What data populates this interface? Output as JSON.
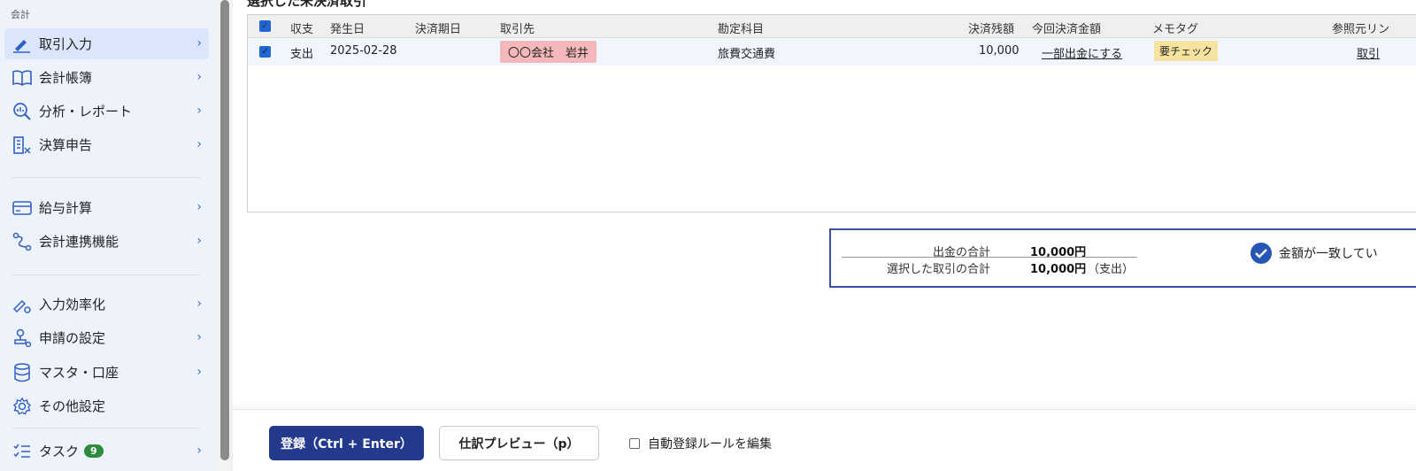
{
  "sidebar": {
    "section_label": "会計",
    "items": [
      {
        "label": "取引入力",
        "icon": "pen-icon"
      },
      {
        "label": "会計帳簿",
        "icon": "book-icon"
      },
      {
        "label": "分析・レポート",
        "icon": "analytics-icon"
      },
      {
        "label": "決算申告",
        "icon": "building-icon"
      },
      {
        "label": "給与計算",
        "icon": "card-icon"
      },
      {
        "label": "会計連携機能",
        "icon": "link-icon"
      },
      {
        "label": "入力効率化",
        "icon": "pen-gear-icon"
      },
      {
        "label": "申請の設定",
        "icon": "stamp-icon"
      },
      {
        "label": "マスタ・口座",
        "icon": "database-icon"
      },
      {
        "label": "その他設定",
        "icon": "gear-icon"
      },
      {
        "label": "タスク",
        "icon": "checklist-icon",
        "badge": "9"
      }
    ],
    "chevron": "›"
  },
  "main": {
    "clipped_title": "選択した未決済取引",
    "table": {
      "headers": {
        "type": "収支",
        "date": "発生日",
        "due": "決済期日",
        "partner": "取引先",
        "account": "勘定科目",
        "balance": "決済残額",
        "amount_now": "今回決済金額",
        "memo": "メモタグ",
        "ref": "参照元リン"
      },
      "rows": [
        {
          "type": "支出",
          "date": "2025-02-28",
          "due": "",
          "partner": "〇〇会社　岩井",
          "account": "旅費交通費",
          "balance": "10,000",
          "amount_now": "一部出金にする",
          "memo": "要チェック",
          "ref": "取引"
        }
      ]
    },
    "summary": {
      "payout_label": "出金の合計",
      "payout_value": "10,000円",
      "selected_label": "選択した取引の合計",
      "selected_value": "10,000円",
      "selected_note": "（支出）",
      "match_text": "金額が一致してい"
    }
  },
  "bottom": {
    "register_label": "登録（Ctrl + Enter）",
    "preview_label": "仕訳プレビュー（p）",
    "auto_rule_label": "自動登録ルールを編集"
  },
  "colors": {
    "primary": "#22398c",
    "accent_blue": "#1f66d4",
    "partner_tag": "#f4b8bb",
    "memo_tag": "#f7e3a0",
    "badge_green": "#2e8b3e"
  }
}
